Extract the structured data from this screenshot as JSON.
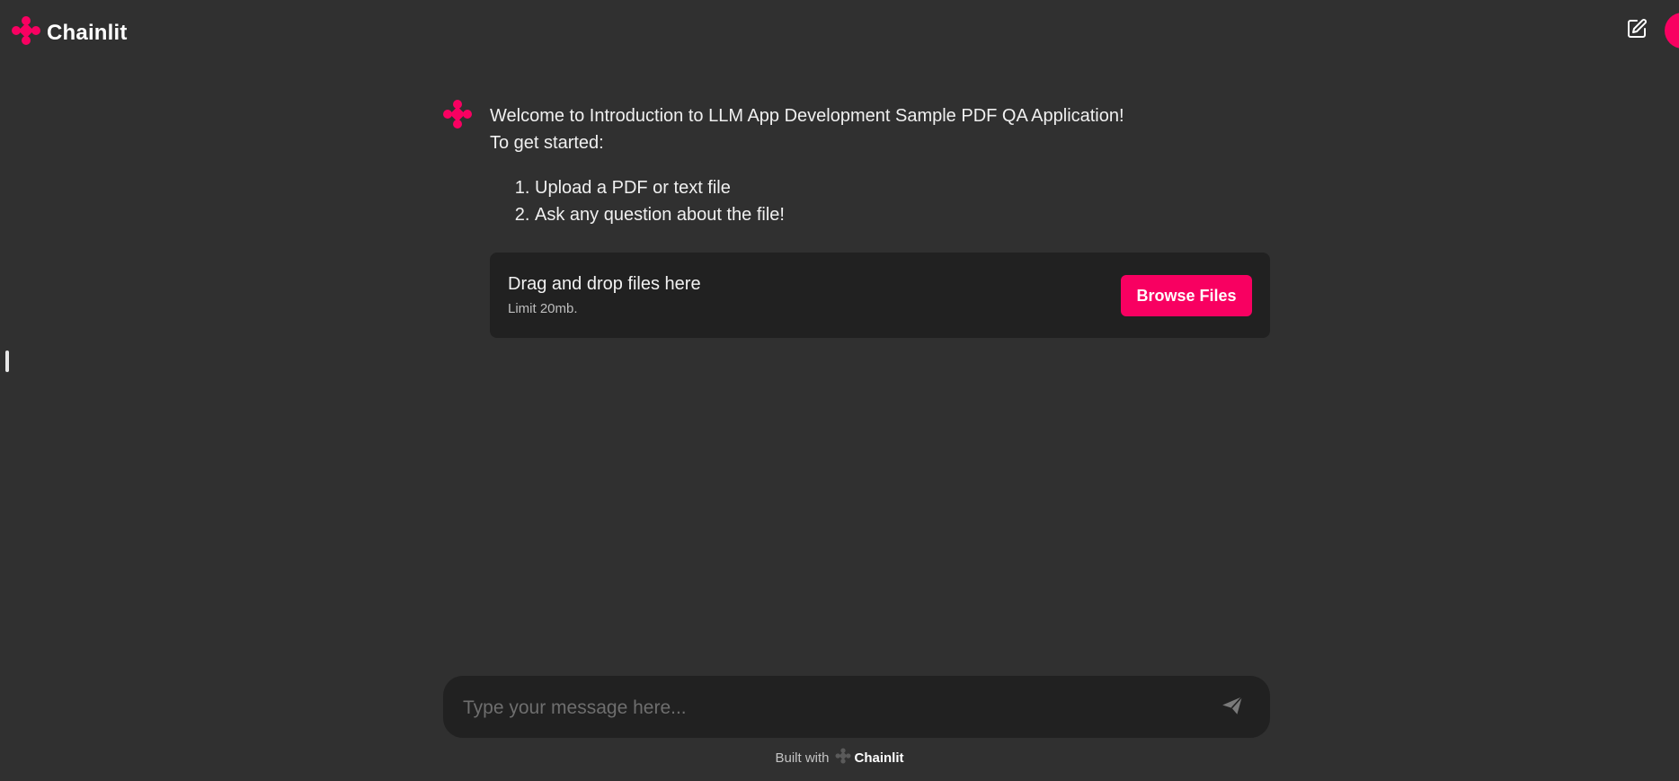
{
  "header": {
    "brand_name": "Chainlit"
  },
  "message": {
    "welcome_line": "Welcome to Introduction to LLM App Development Sample PDF QA Application!",
    "intro_line": "To get started:",
    "steps": [
      "Upload a PDF or text file",
      "Ask any question about the file!"
    ]
  },
  "upload": {
    "title": "Drag and drop files here",
    "limit": "Limit 20mb.",
    "button_label": "Browse Files"
  },
  "composer": {
    "placeholder": "Type your message here..."
  },
  "footer": {
    "built_with": "Built with",
    "brand_name": "Chainlit"
  },
  "colors": {
    "background": "#303030",
    "surface": "#212121",
    "accent": "#f80061"
  },
  "icons": {
    "brand": "chainlit-logo-icon",
    "new_chat": "edit-icon",
    "send": "send-icon",
    "user": "user-avatar"
  }
}
